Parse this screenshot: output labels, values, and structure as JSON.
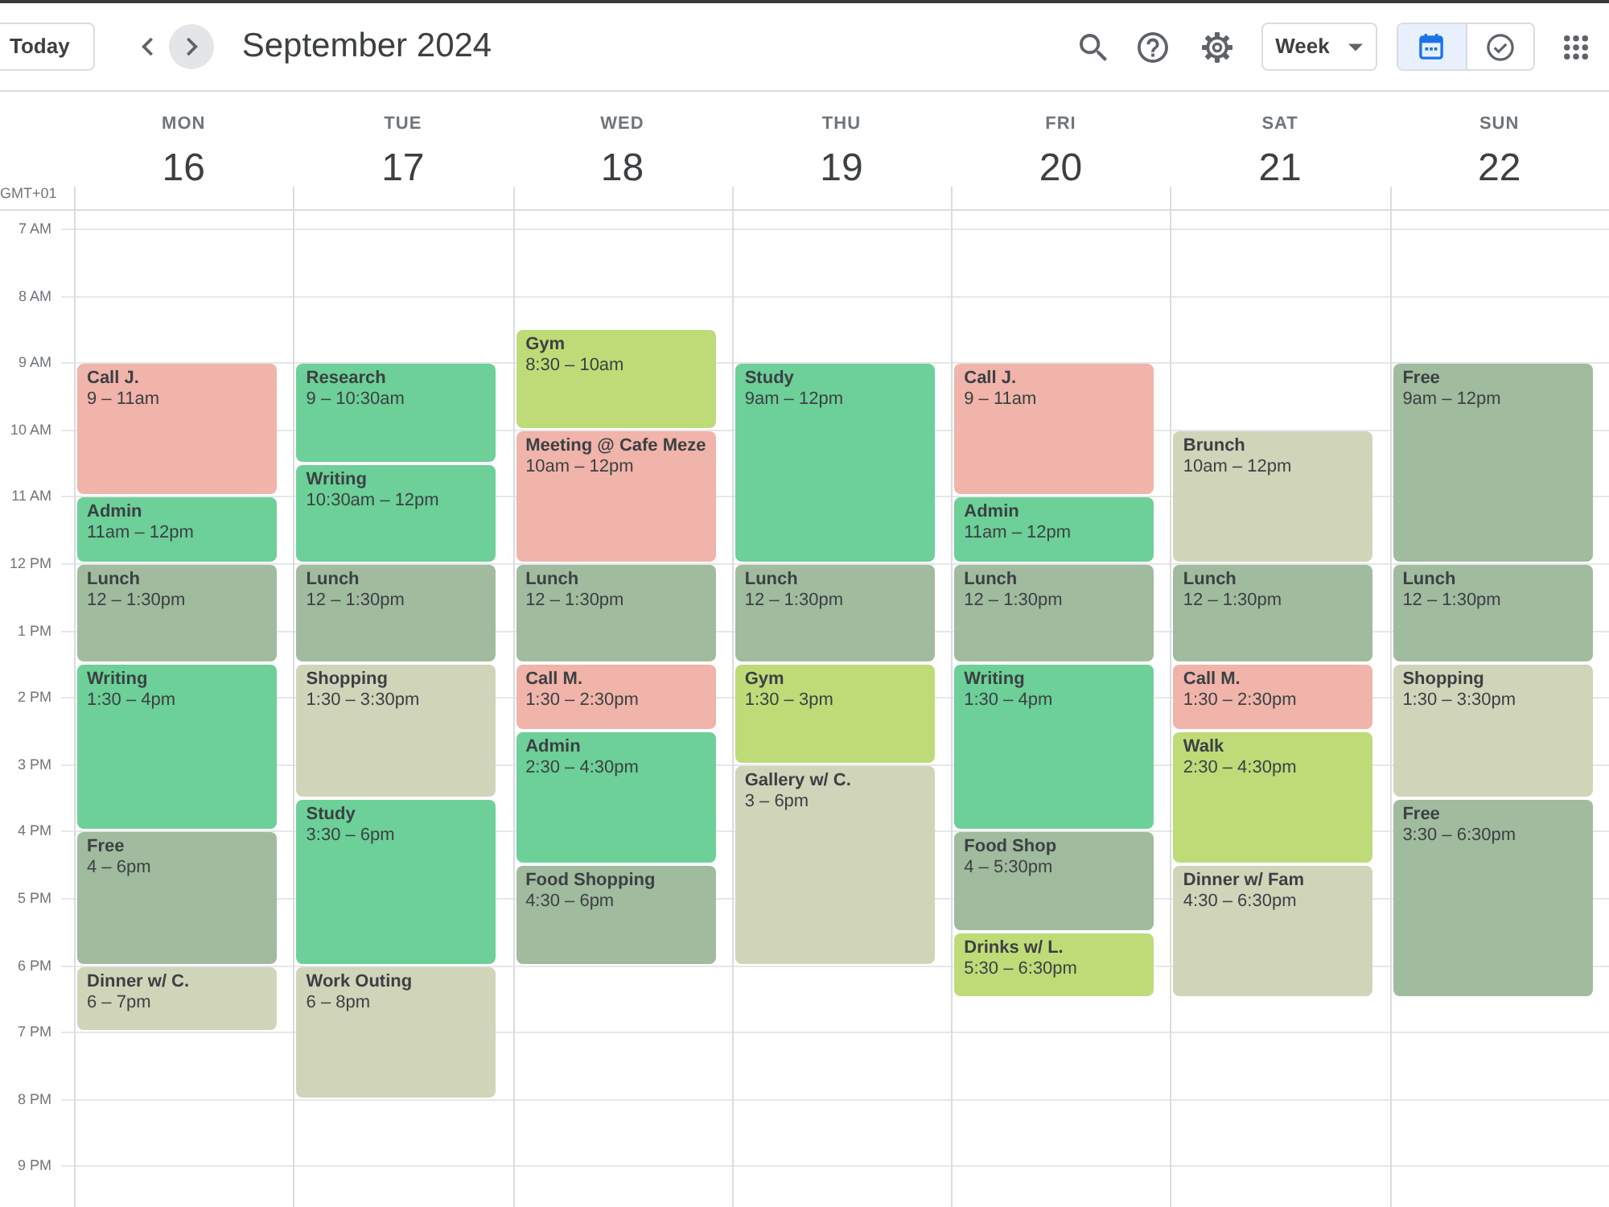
{
  "toolbar": {
    "today_button": "Today",
    "nav_buttons": [
      {
        "kind": "previous",
        "highlighted": false
      },
      {
        "kind": "next",
        "highlighted": true
      }
    ],
    "title": "September 2024",
    "view_dropdown": "Week",
    "view_toggle": [
      {
        "kind": "calendar",
        "selected": true
      },
      {
        "kind": "tasks",
        "selected": false
      }
    ]
  },
  "timezone": "GMT+01",
  "hours": [
    "7 AM",
    "8 AM",
    "9 AM",
    "10 AM",
    "11 AM",
    "12 PM",
    "1 PM",
    "2 PM",
    "3 PM",
    "4 PM",
    "5 PM",
    "6 PM",
    "7 PM",
    "8 PM",
    "9 PM"
  ],
  "days": [
    {
      "weekday": "MON",
      "date": "16",
      "events": [
        {
          "title": "Call J.",
          "time": "9 – 11am",
          "color": "#f0b4aa"
        },
        {
          "title": "Admin",
          "time": "11am – 12pm",
          "color": "#6cd098"
        },
        {
          "title": "Lunch",
          "time": "12 – 1:30pm",
          "color": "#a0bb9e"
        },
        {
          "title": "Writing",
          "time": "1:30 – 4pm",
          "color": "#6cd098"
        },
        {
          "title": "Free",
          "time": "4 – 6pm",
          "color": "#a0bb9e"
        },
        {
          "title": "Dinner w/ C.",
          "time": "6 – 7pm",
          "color": "#d0d4b9"
        }
      ]
    },
    {
      "weekday": "TUE",
      "date": "17",
      "events": [
        {
          "title": "Research",
          "time": "9 – 10:30am",
          "color": "#6cd098"
        },
        {
          "title": "Writing",
          "time": "10:30am – 12pm",
          "color": "#6cd098"
        },
        {
          "title": "Lunch",
          "time": "12 – 1:30pm",
          "color": "#a0bb9e"
        },
        {
          "title": "Shopping",
          "time": "1:30 – 3:30pm",
          "color": "#d0d4b9"
        },
        {
          "title": "Study",
          "time": "3:30 – 6pm",
          "color": "#6cd098"
        },
        {
          "title": "Work Outing",
          "time": "6 – 8pm",
          "color": "#d0d4b9"
        }
      ]
    },
    {
      "weekday": "WED",
      "date": "18",
      "events": [
        {
          "title": "Gym",
          "time": "8:30 – 10am",
          "color": "#bedb78"
        },
        {
          "title": "Meeting @ Cafe Meze",
          "time": "10am – 12pm",
          "color": "#f0b4aa"
        },
        {
          "title": "Lunch",
          "time": "12 – 1:30pm",
          "color": "#a0bb9e"
        },
        {
          "title": "Call M.",
          "time": "1:30 – 2:30pm",
          "color": "#f0b4aa"
        },
        {
          "title": "Admin",
          "time": "2:30 – 4:30pm",
          "color": "#6cd098"
        },
        {
          "title": "Food Shopping",
          "time": "4:30 – 6pm",
          "color": "#a0bb9e"
        }
      ]
    },
    {
      "weekday": "THU",
      "date": "19",
      "events": [
        {
          "title": "Study",
          "time": "9am – 12pm",
          "color": "#6cd098"
        },
        {
          "title": "Lunch",
          "time": "12 – 1:30pm",
          "color": "#a0bb9e"
        },
        {
          "title": "Gym",
          "time": "1:30 – 3pm",
          "color": "#bedb78"
        },
        {
          "title": "Gallery w/ C.",
          "time": "3 – 6pm",
          "color": "#d0d4b9"
        }
      ]
    },
    {
      "weekday": "FRI",
      "date": "20",
      "events": [
        {
          "title": "Call J.",
          "time": "9 – 11am",
          "color": "#f0b4aa"
        },
        {
          "title": "Admin",
          "time": "11am – 12pm",
          "color": "#6cd098"
        },
        {
          "title": "Lunch",
          "time": "12 – 1:30pm",
          "color": "#a0bb9e"
        },
        {
          "title": "Writing",
          "time": "1:30 – 4pm",
          "color": "#6cd098"
        },
        {
          "title": "Food Shop",
          "time": "4 – 5:30pm",
          "color": "#a0bb9e"
        },
        {
          "title": "Drinks w/ L.",
          "time": "5:30 – 6:30pm",
          "color": "#bedb78"
        }
      ]
    },
    {
      "weekday": "SAT",
      "date": "21",
      "events": [
        {
          "title": "Brunch",
          "time": "10am – 12pm",
          "color": "#d0d4b9"
        },
        {
          "title": "Lunch",
          "time": "12 – 1:30pm",
          "color": "#a0bb9e"
        },
        {
          "title": "Call M.",
          "time": "1:30 – 2:30pm",
          "color": "#f0b4aa"
        },
        {
          "title": "Walk",
          "time": "2:30 – 4:30pm",
          "color": "#bedb78"
        },
        {
          "title": "Dinner w/ Fam",
          "time": "4:30 – 6:30pm",
          "color": "#d0d4b9"
        }
      ]
    },
    {
      "weekday": "SUN",
      "date": "22",
      "events": [
        {
          "title": "Free",
          "time": "9am – 12pm",
          "color": "#a0bb9e"
        },
        {
          "title": "Lunch",
          "time": "12 – 1:30pm",
          "color": "#a0bb9e"
        },
        {
          "title": "Shopping",
          "time": "1:30 – 3:30pm",
          "color": "#d0d4b9"
        },
        {
          "title": "Free",
          "time": "3:30 – 6:30pm",
          "color": "#a0bb9e"
        }
      ]
    }
  ]
}
